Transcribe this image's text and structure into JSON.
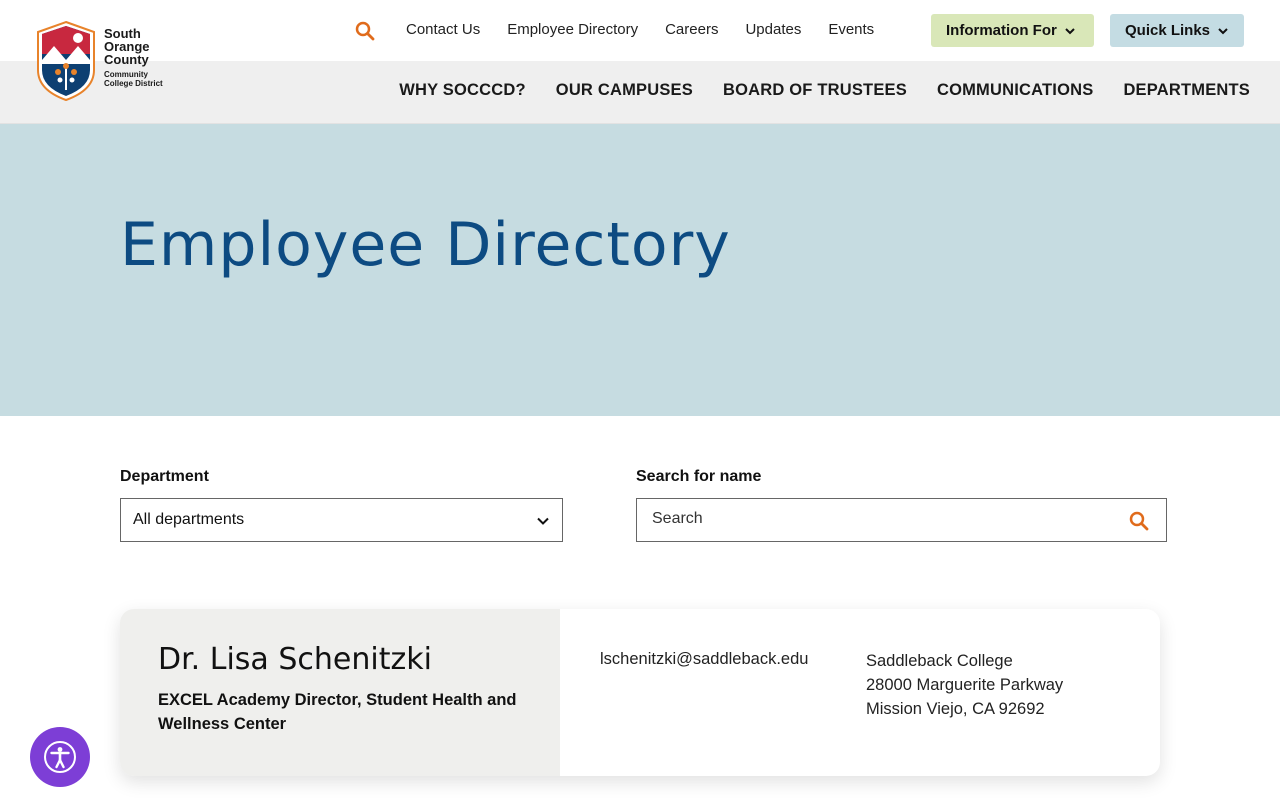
{
  "logo": {
    "line1": "South",
    "line2": "Orange",
    "line3": "County",
    "line4": "Community",
    "line5": "College District"
  },
  "topnav": {
    "links": [
      "Contact Us",
      "Employee Directory",
      "Careers",
      "Updates",
      "Events"
    ],
    "information_for": "Information For",
    "quick_links": "Quick Links"
  },
  "mainnav": {
    "items": [
      "WHY SOCCCD?",
      "OUR CAMPUSES",
      "BOARD OF TRUSTEES",
      "COMMUNICATIONS",
      "DEPARTMENTS"
    ]
  },
  "hero": {
    "title": "Employee Directory"
  },
  "filters": {
    "department_label": "Department",
    "department_value": "All departments",
    "search_label": "Search for name",
    "search_placeholder": "Search"
  },
  "employee": {
    "name": "Dr. Lisa Schenitzki",
    "title": "EXCEL Academy Director, Student Health and Wellness Center",
    "email": "lschenitzki@saddleback.edu",
    "address_line1": "Saddleback College",
    "address_line2": "28000 Marguerite Parkway",
    "address_line3": "Mission Viejo, CA 92692"
  },
  "colors": {
    "accent_orange": "#e06b1b",
    "title_blue": "#0d4b82",
    "hero_bg": "#c6dce1",
    "info_btn_bg": "#d9e7b8",
    "quick_btn_bg": "#c4dce3",
    "a11y_purple": "#7d3ed6"
  },
  "icons": {
    "search": "search-icon",
    "chevron": "chevron-down-icon",
    "accessibility": "accessibility-icon"
  }
}
